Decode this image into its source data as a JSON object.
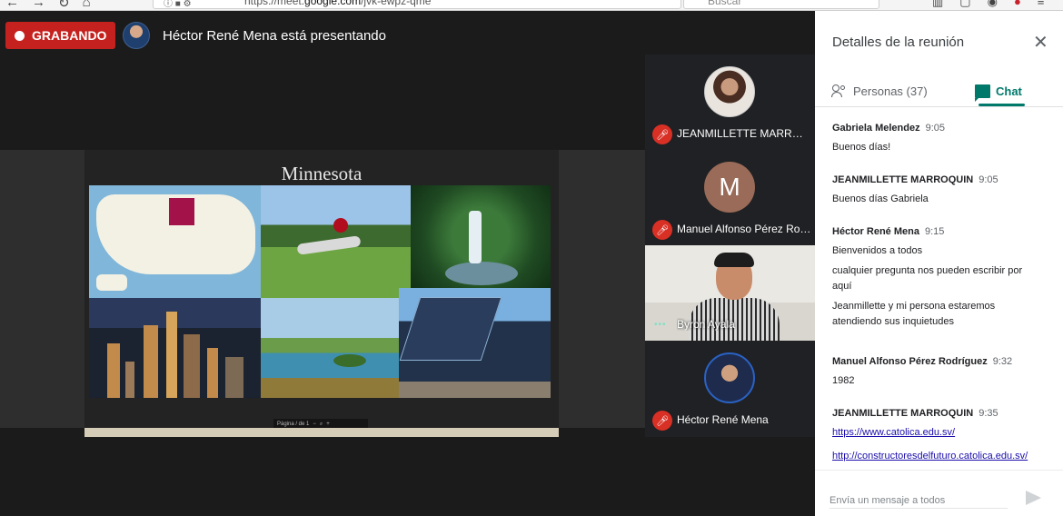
{
  "browser": {
    "url_prefix": "https://meet.",
    "url_domain": "google.com",
    "url_path": "/jvk-ewpz-qme",
    "search_placeholder": "Buscar"
  },
  "header": {
    "recording_label": "GRABANDO",
    "presenting_text": "Héctor René Mena está presentando"
  },
  "slide": {
    "title": "Minnesota",
    "toolbar_text": "Página   /   de   1"
  },
  "participants": [
    {
      "name": "JEANMILLETTE MARROQUIN"
    },
    {
      "name": "Manuel Alfonso Pérez Rodríguez",
      "initial": "M"
    },
    {
      "name": "Byron Ayala"
    },
    {
      "name": "Héctor René Mena"
    }
  ],
  "panel": {
    "title": "Detalles de la reunión",
    "tab_people": "Personas (37)",
    "tab_chat": "Chat",
    "compose_placeholder": "Envía un mensaje a todos"
  },
  "messages": [
    {
      "sender": "Gabriela Melendez",
      "time": "9:05",
      "lines": [
        "Buenos días!"
      ]
    },
    {
      "sender": "JEANMILLETTE MARROQUIN",
      "time": "9:05",
      "lines": [
        "Buenos días Gabriela"
      ]
    },
    {
      "sender": "Héctor René Mena",
      "time": "9:15",
      "lines": [
        "Bienvenidos a todos",
        "cualquier pregunta nos pueden escribir por aquí",
        "Jeanmillette y mi persona estaremos atendiendo sus inquietudes"
      ]
    },
    {
      "sender": "Manuel Alfonso Pérez Rodríguez",
      "time": "9:32",
      "lines": [
        "1982"
      ]
    },
    {
      "sender": "JEANMILLETTE MARROQUIN",
      "time": "9:35",
      "links": [
        "https://www.catolica.edu.sv/",
        "http://constructoresdelfuturo.catolica.edu.sv/"
      ]
    }
  ],
  "colors": {
    "record": "#c5221f",
    "accent": "#00796b",
    "mic_off": "#d93025",
    "link": "#1a0dab"
  }
}
